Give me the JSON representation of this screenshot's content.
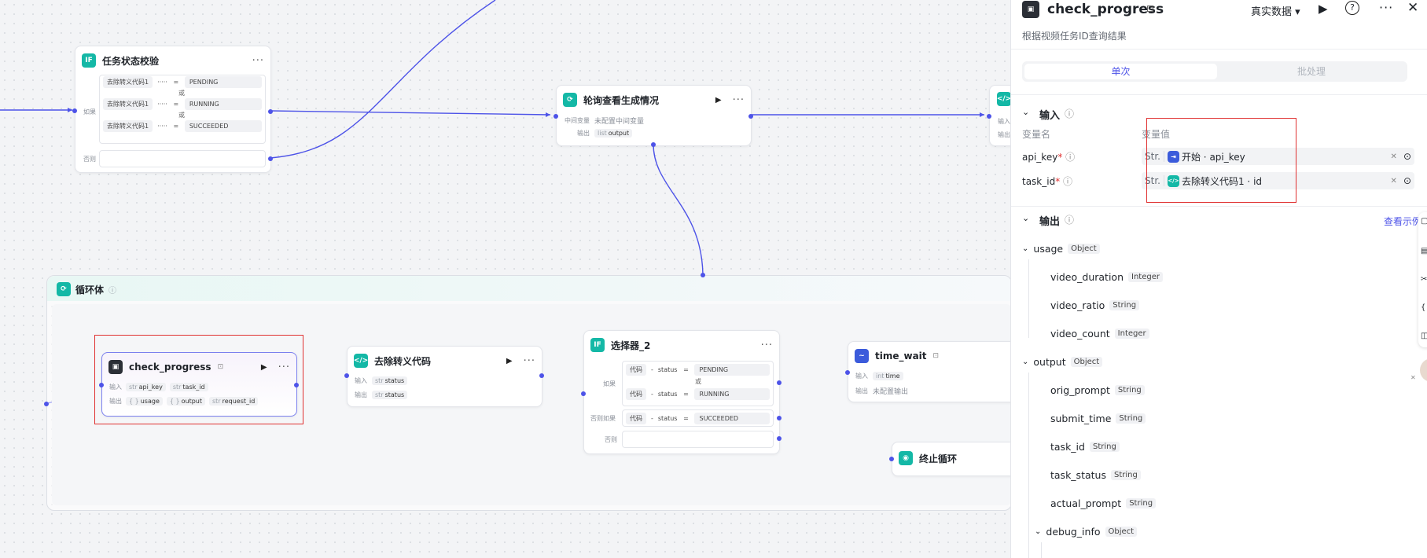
{
  "canvas": {
    "node_if1": {
      "title": "任务状态校验",
      "label_if": "如果",
      "label_else": "否则",
      "conditions": [
        {
          "left": "去除转义代码1",
          "dots": "·····",
          "op": "=",
          "value": "PENDING"
        },
        {
          "left": "去除转义代码1",
          "dots": "·····",
          "op": "=",
          "value": "RUNNING"
        },
        {
          "left": "去除转义代码1",
          "dots": "·····",
          "op": "=",
          "value": "SUCCEEDED"
        }
      ],
      "or": "或"
    },
    "node_poll": {
      "title": "轮询查看生成情况",
      "row1_label": "中间变量",
      "row1_value": "未配置中间变量",
      "row2_label": "输出",
      "row2_type": "list",
      "row2_value": "output"
    },
    "node_partial": {
      "row1_label": "输入",
      "row2_label": "输出"
    },
    "loop": {
      "title": "循环体"
    },
    "node_check": {
      "title": "check_progress",
      "in_label": "输入",
      "in_tags": [
        {
          "t": "str",
          "v": "api_key"
        },
        {
          "t": "str",
          "v": "task_id"
        }
      ],
      "out_label": "输出",
      "out_tags": [
        {
          "t": "{ }",
          "v": "usage"
        },
        {
          "t": "{ }",
          "v": "output"
        },
        {
          "t": "str",
          "v": "request_id"
        }
      ]
    },
    "node_strip": {
      "title": "去除转义代码",
      "in_label": "输入",
      "in_type": "str",
      "in_value": "status",
      "out_label": "输出",
      "out_type": "str",
      "out_value": "status"
    },
    "node_sel": {
      "title": "选择器_2",
      "label_if": "如果",
      "label_elif": "否则如果",
      "label_else": "否则",
      "or": "或",
      "conditions": [
        {
          "left": "代码",
          "sep": "-",
          "field": "status",
          "op": "=",
          "value": "PENDING"
        },
        {
          "left": "代码",
          "sep": "-",
          "field": "status",
          "op": "=",
          "value": "RUNNING"
        },
        {
          "left": "代码",
          "sep": "-",
          "field": "status",
          "op": "=",
          "value": "SUCCEEDED"
        }
      ]
    },
    "node_wait": {
      "title": "time_wait",
      "in_label": "输入",
      "in_type": "int",
      "in_value": "time",
      "out_label": "输出",
      "out_value": "未配置输出"
    },
    "node_break": {
      "title": "终止循环"
    }
  },
  "panel": {
    "title": "check_progress",
    "subtitle": "根据视频任务ID查询结果",
    "mode": "真实数据",
    "tabs": [
      "单次",
      "批处理"
    ],
    "input_section": "输入",
    "col_name": "变量名",
    "col_value": "变量值",
    "inputs": [
      {
        "name": "api_key",
        "type": "Str.",
        "source": "开始",
        "field": "api_key"
      },
      {
        "name": "task_id",
        "type": "Str.",
        "source": "去除转义代码1",
        "field": "id"
      }
    ],
    "output_section": "输出",
    "view_example": "查看示例",
    "tree": [
      {
        "name": "usage",
        "type": "Object"
      },
      {
        "name": "video_duration",
        "type": "Integer"
      },
      {
        "name": "video_ratio",
        "type": "String"
      },
      {
        "name": "video_count",
        "type": "Integer"
      },
      {
        "name": "output",
        "type": "Object"
      },
      {
        "name": "orig_prompt",
        "type": "String"
      },
      {
        "name": "submit_time",
        "type": "String"
      },
      {
        "name": "task_id",
        "type": "String"
      },
      {
        "name": "task_status",
        "type": "String"
      },
      {
        "name": "actual_prompt",
        "type": "String"
      },
      {
        "name": "debug_info",
        "type": "Object"
      }
    ]
  }
}
